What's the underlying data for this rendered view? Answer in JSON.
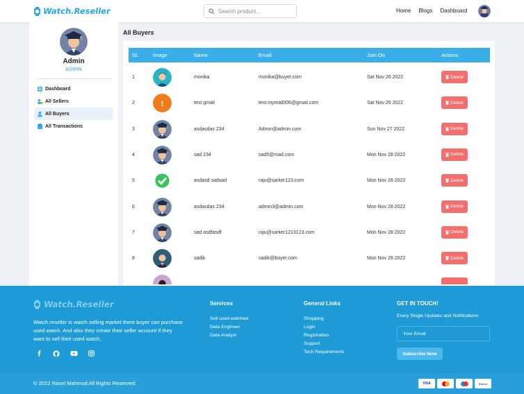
{
  "brand": {
    "name": "Watch.Reseller"
  },
  "search": {
    "placeholder": "Search product..."
  },
  "nav": {
    "links": [
      "Home",
      "Blogs",
      "Dashboard"
    ]
  },
  "sidebar": {
    "name": "Admin",
    "role": "ADMIN",
    "items": [
      {
        "label": "Dashboard",
        "icon": "dashboard-icon"
      },
      {
        "label": "All Sellers",
        "icon": "sellers-icon"
      },
      {
        "label": "All Buyers",
        "icon": "buyers-icon",
        "active": true
      },
      {
        "label": "All Transactions",
        "icon": "transactions-icon"
      }
    ]
  },
  "main": {
    "title": "All Buyers",
    "columns": [
      "SL",
      "Image",
      "Name",
      "Email",
      "Join On",
      "Actions"
    ],
    "delete_label": "Delete",
    "rows": [
      {
        "sl": "1",
        "avatar": "teal-person",
        "name": "monika",
        "email": "monika@buyer.com",
        "joined": "Sat Nov 26 2022"
      },
      {
        "sl": "2",
        "avatar": "letter-t",
        "letter": "t",
        "name": "test gmail",
        "email": "test.mymail006@gmail.com",
        "joined": "Sat Nov 26 2022"
      },
      {
        "sl": "3",
        "avatar": "graduate",
        "name": "asdasdas 234",
        "email": "Admin@admin.com",
        "joined": "Sun Nov 27 2022"
      },
      {
        "sl": "4",
        "avatar": "graduate",
        "name": "sad 234",
        "email": "sad5@mad.com",
        "joined": "Mon Nov 28 2022"
      },
      {
        "sl": "5",
        "avatar": "check",
        "name": "asdasd sadsad",
        "email": "raju@sarker123.com",
        "joined": "Mon Nov 28 2022"
      },
      {
        "sl": "6",
        "avatar": "graduate",
        "name": "asdasdas 234",
        "email": "admin3@admin.com",
        "joined": "Mon Nov 28 2022"
      },
      {
        "sl": "7",
        "avatar": "graduate",
        "name": "sad asdfasdf",
        "email": "raju@sarker1213123.com",
        "joined": "Mon Nov 28 2022"
      },
      {
        "sl": "8",
        "avatar": "suit-man",
        "name": "sadik",
        "email": "sadik@buyer.com",
        "joined": "Mon Nov 28 2022"
      }
    ]
  },
  "footer": {
    "brand": "Watch.Reseller",
    "description": "Watch.reseller is watch selling market there buyer can purchase used watch. And also they create their seller account if they want to sell their used watch,",
    "social": [
      "facebook-icon",
      "github-icon",
      "youtube-icon",
      "instagram-icon"
    ],
    "services": {
      "title": "Services",
      "items": [
        "Sell used watched",
        "Data Engineer",
        "Data Analyst"
      ]
    },
    "links": {
      "title": "General Links",
      "items": [
        "Shopping",
        "Login",
        "Registration",
        "Support",
        "Tech Requirements"
      ]
    },
    "contact": {
      "title": "GET IN TOUCH!",
      "subtitle": "Every Single Updates and Notifications",
      "email_placeholder": "Your Email",
      "button": "Subscribe Now"
    },
    "copyright": "© 2022 Rasel Mahmud All Rights Reserved.",
    "cards": [
      "VISA",
      "mastercard",
      "maestro",
      "Diners"
    ]
  },
  "colors": {
    "primary": "#28a7e0",
    "header": "#3aaee6",
    "delete": "#f46e6e",
    "footer": "#1e9bd7"
  }
}
